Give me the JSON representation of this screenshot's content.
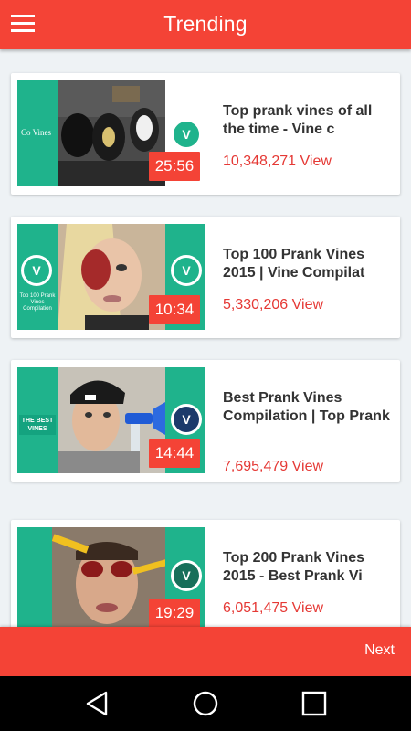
{
  "header": {
    "title": "Trending",
    "menu_icon": "hamburger-menu-icon"
  },
  "colors": {
    "accent": "#f44336",
    "vine_green": "#1fb38c",
    "views_red": "#e53935"
  },
  "videos": [
    {
      "title": "Top prank vines of all the time - Vine c",
      "views": "10,348,271 View",
      "duration": "25:56",
      "thumb_text": "Co Vines"
    },
    {
      "title": "Top 100 Prank Vines 2015 | Vine Compilat",
      "views": "5,330,206 View",
      "duration": "10:34",
      "thumb_text": "Top 100 Prank Vines Compilation"
    },
    {
      "title": "Best Prank Vines Compilation | Top Prank",
      "views": "7,695,479 View",
      "duration": "14:44",
      "thumb_text": "THE BEST VINES"
    },
    {
      "title": "Top 200 Prank Vines 2015 - Best Prank Vi",
      "views": "6,051,475 View",
      "duration": "19:29",
      "thumb_text": ""
    }
  ],
  "footer": {
    "next_label": "Next"
  },
  "system_nav": {
    "back_icon": "back-triangle-icon",
    "home_icon": "home-circle-icon",
    "recent_icon": "recent-apps-square-icon"
  }
}
